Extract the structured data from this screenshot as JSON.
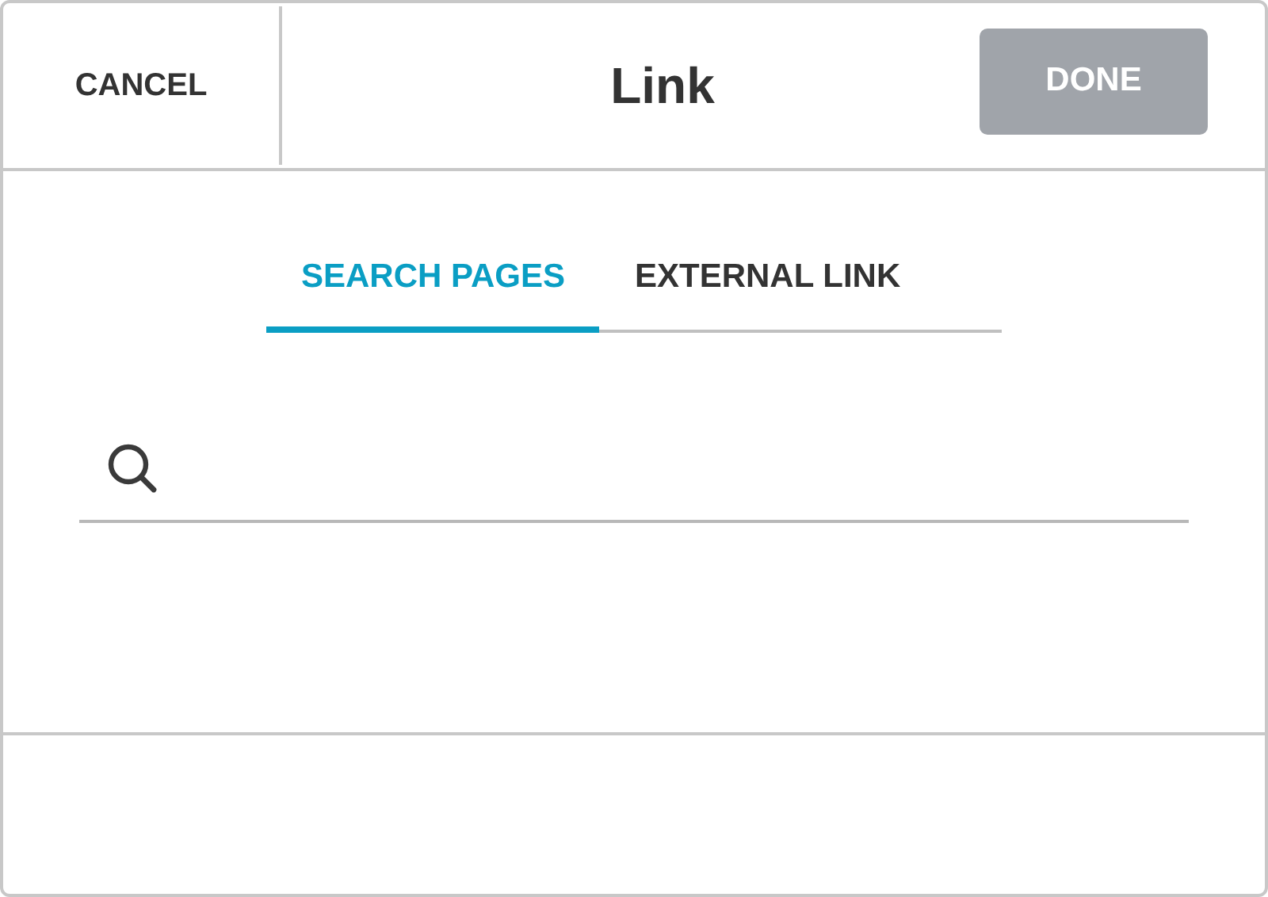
{
  "header": {
    "cancel": "CANCEL",
    "title": "Link",
    "done": {
      "label": "DONE",
      "disabled": true
    }
  },
  "tabs": [
    {
      "label": "SEARCH PAGES",
      "selected": true
    },
    {
      "label": "EXTERNAL LINK",
      "selected": false
    }
  ]
}
